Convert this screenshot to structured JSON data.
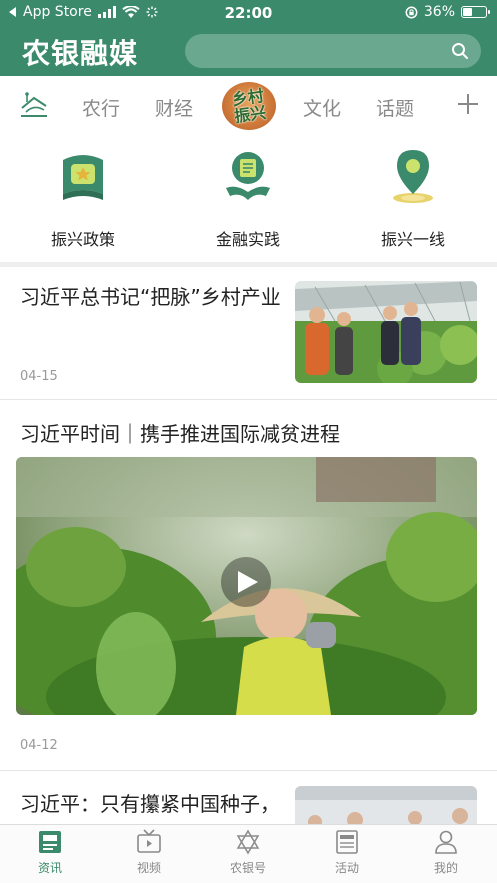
{
  "status_bar": {
    "back_app": "App Store",
    "time": "22:00",
    "battery_pct": "36%",
    "battery_level": 0.36
  },
  "header": {
    "title": "农银融媒",
    "search_placeholder": ""
  },
  "tabs": [
    {
      "label": "农行"
    },
    {
      "label": "财经"
    },
    {
      "label": "乡村振兴",
      "icon": "rural-revival-badge"
    },
    {
      "label": "文化"
    },
    {
      "label": "话题"
    }
  ],
  "categories": [
    {
      "label": "振兴政策",
      "icon": "policy-book-icon"
    },
    {
      "label": "金融实践",
      "icon": "finance-practice-icon"
    },
    {
      "label": "振兴一线",
      "icon": "location-pin-icon"
    }
  ],
  "articles": [
    {
      "title": "习近平总书记“把脉”乡村产业",
      "date": "04-15"
    },
    {
      "title": "习近平时间｜携手推进国际减贫进程",
      "date": "04-12"
    },
    {
      "title": "习近平：只有攥紧中国种子，才能端稳中国饭碗"
    }
  ],
  "bottom_nav": [
    {
      "label": "资讯",
      "icon": "news-icon",
      "active": true
    },
    {
      "label": "视频",
      "icon": "tv-icon"
    },
    {
      "label": "农银号",
      "icon": "star-of-david-icon"
    },
    {
      "label": "活动",
      "icon": "newspaper-icon"
    },
    {
      "label": "我的",
      "icon": "user-icon"
    }
  ],
  "colors": {
    "brand": "#3b8a6b",
    "text": "#222222",
    "muted": "#999999"
  }
}
